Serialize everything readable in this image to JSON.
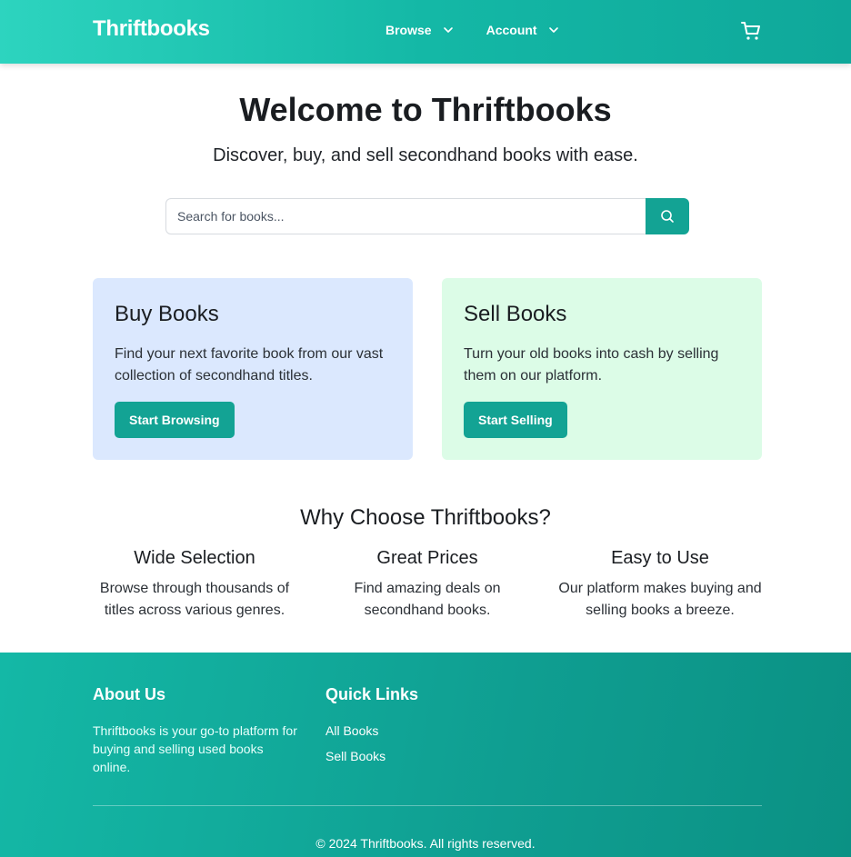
{
  "header": {
    "logo": "Thriftbooks",
    "nav": [
      {
        "label": "Browse"
      },
      {
        "label": "Account"
      }
    ]
  },
  "hero": {
    "title": "Welcome to Thriftbooks",
    "subtitle": "Discover, buy, and sell secondhand books with ease."
  },
  "search": {
    "placeholder": "Search for books...",
    "value": ""
  },
  "cards": {
    "buy": {
      "title": "Buy Books",
      "text": "Find your next favorite book from our vast collection of secondhand titles.",
      "button": "Start Browsing"
    },
    "sell": {
      "title": "Sell Books",
      "text": "Turn your old books into cash by selling them on our platform.",
      "button": "Start Selling"
    }
  },
  "why": {
    "title": "Why Choose Thriftbooks?",
    "features": [
      {
        "title": "Wide Selection",
        "text": "Browse through thousands of titles across various genres."
      },
      {
        "title": "Great Prices",
        "text": "Find amazing deals on secondhand books."
      },
      {
        "title": "Easy to Use",
        "text": "Our platform makes buying and selling books a breeze."
      }
    ]
  },
  "footer": {
    "about_title": "About Us",
    "about_text": "Thriftbooks is your go-to platform for buying and selling used books online.",
    "links_title": "Quick Links",
    "links": [
      "All Books",
      "Sell Books"
    ],
    "copyright": "© 2024 Thriftbooks. All rights reserved."
  },
  "colors": {
    "accent": "#13a394",
    "buy_card_bg": "#dbe8fe",
    "sell_card_bg": "#dcfce7"
  },
  "icons": {
    "cart": "cart-icon",
    "search": "search-icon",
    "chevron": "chevron-down-icon"
  }
}
